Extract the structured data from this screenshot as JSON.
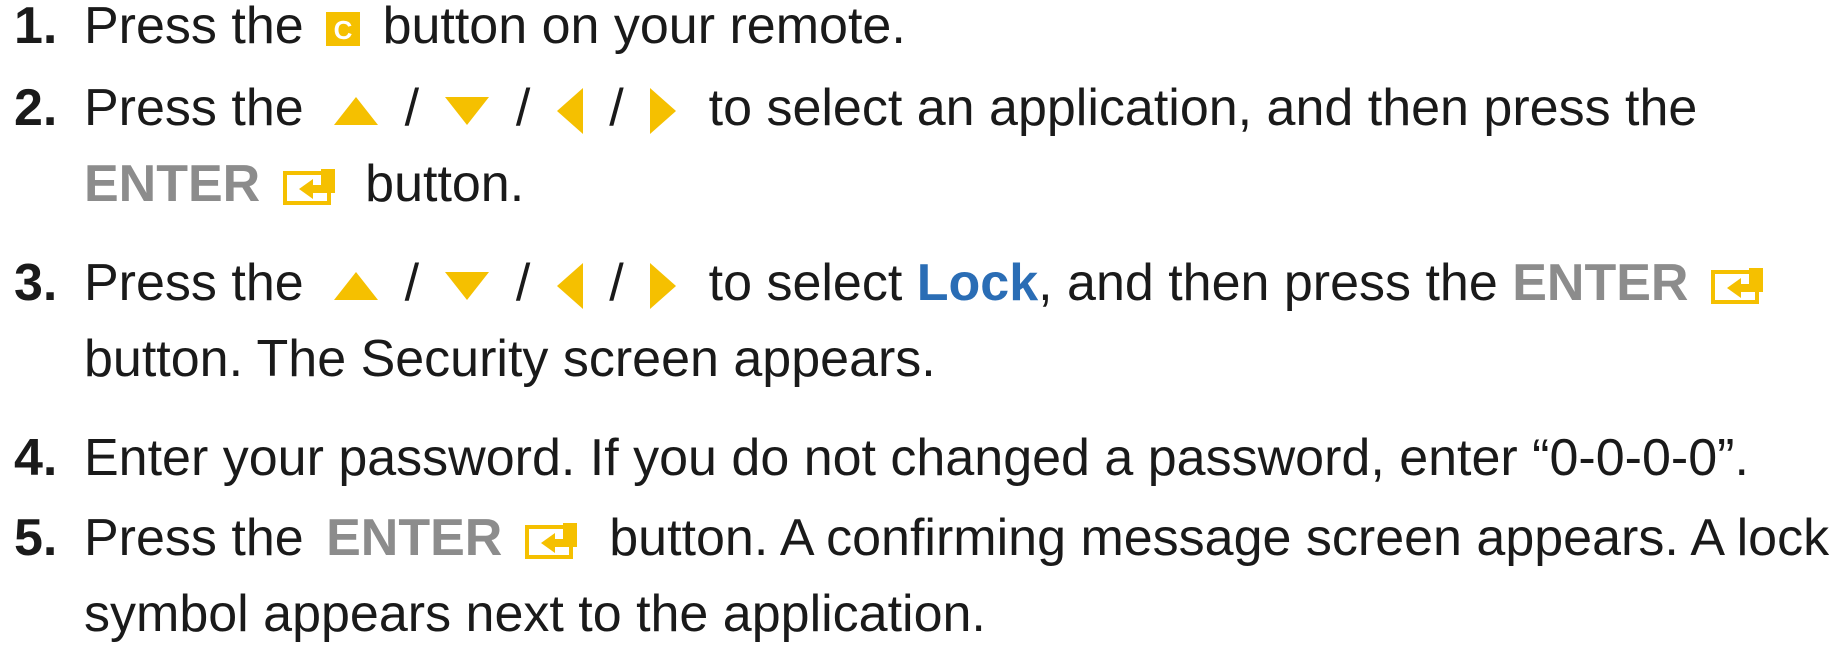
{
  "colors": {
    "accent_yellow": "#F5C000",
    "enter_gray": "#8C8C8C",
    "link_blue": "#2A6DB5",
    "text": "#1A1A1A"
  },
  "steps": [
    {
      "number": "1.",
      "text_a": "Press the",
      "c_icon_letter": "C",
      "text_b": "button on your remote."
    },
    {
      "number": "2.",
      "text_a": "Press the",
      "sep": "/",
      "text_b": "to select an application, and then press the",
      "enter": "ENTER",
      "text_c": "button."
    },
    {
      "number": "3.",
      "text_a": "Press the",
      "sep": "/",
      "text_b": "to select",
      "highlight": "Lock",
      "text_c": ", and then press the",
      "enter": "ENTER",
      "text_d": "button. The Security screen appears."
    },
    {
      "number": "4.",
      "text_a": "Enter your password. If you do not changed a password, enter “0-0-0-0”."
    },
    {
      "number": "5.",
      "text_a": "Press the",
      "enter": "ENTER",
      "text_b": "button. A confirming message screen appears. A lock",
      "text_c": "symbol appears next to the application."
    }
  ],
  "icons": [
    "c-button-icon",
    "up-arrow-icon",
    "down-arrow-icon",
    "left-arrow-icon",
    "right-arrow-icon",
    "enter-icon"
  ]
}
